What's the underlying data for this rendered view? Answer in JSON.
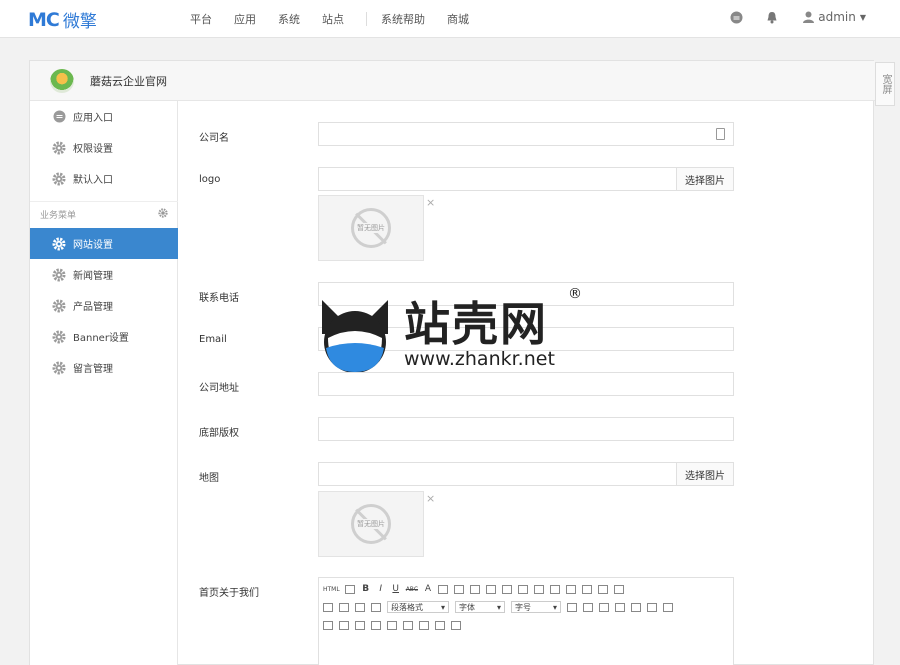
{
  "brand": {
    "mark": "MC",
    "name": "微擎"
  },
  "topnav": {
    "items": [
      "平台",
      "应用",
      "系统",
      "站点",
      "系统帮助",
      "商城"
    ]
  },
  "user": {
    "name": "admin"
  },
  "site": {
    "name": "蘑菇云企业官网"
  },
  "wide_button": "宽屏",
  "sidebar": {
    "items": [
      {
        "label": "应用入口",
        "icon": "chat-icon"
      },
      {
        "label": "权限设置",
        "icon": "gear-icon"
      },
      {
        "label": "默认入口",
        "icon": "gear-icon"
      }
    ],
    "group_title": "业务菜单",
    "business": [
      {
        "label": "网站设置",
        "icon": "gear-icon",
        "active": true
      },
      {
        "label": "新闻管理",
        "icon": "gear-icon"
      },
      {
        "label": "产品管理",
        "icon": "gear-icon"
      },
      {
        "label": "Banner设置",
        "icon": "gear-icon"
      },
      {
        "label": "留言管理",
        "icon": "gear-icon"
      }
    ]
  },
  "form": {
    "company_label": "公司名",
    "logo_label": "logo",
    "pick_image": "选择图片",
    "placeholder_image": "暂无图片",
    "remove": "×",
    "phone_label": "联系电话",
    "email_label": "Email",
    "address_label": "公司地址",
    "copyright_label": "底部版权",
    "map_label": "地图",
    "about_label": "首页关于我们"
  },
  "editor": {
    "html": "HTML",
    "bold": "B",
    "italic": "I",
    "underline": "U",
    "strike": "ABC",
    "font_color": "A",
    "paragraph": "段落格式",
    "font": "字体",
    "size": "字号"
  },
  "watermark": {
    "title": "站壳网",
    "reg": "®",
    "url": "www.zhankr.net"
  },
  "colors": {
    "accent": "#3a87cf",
    "brand": "#2f7ad6"
  }
}
